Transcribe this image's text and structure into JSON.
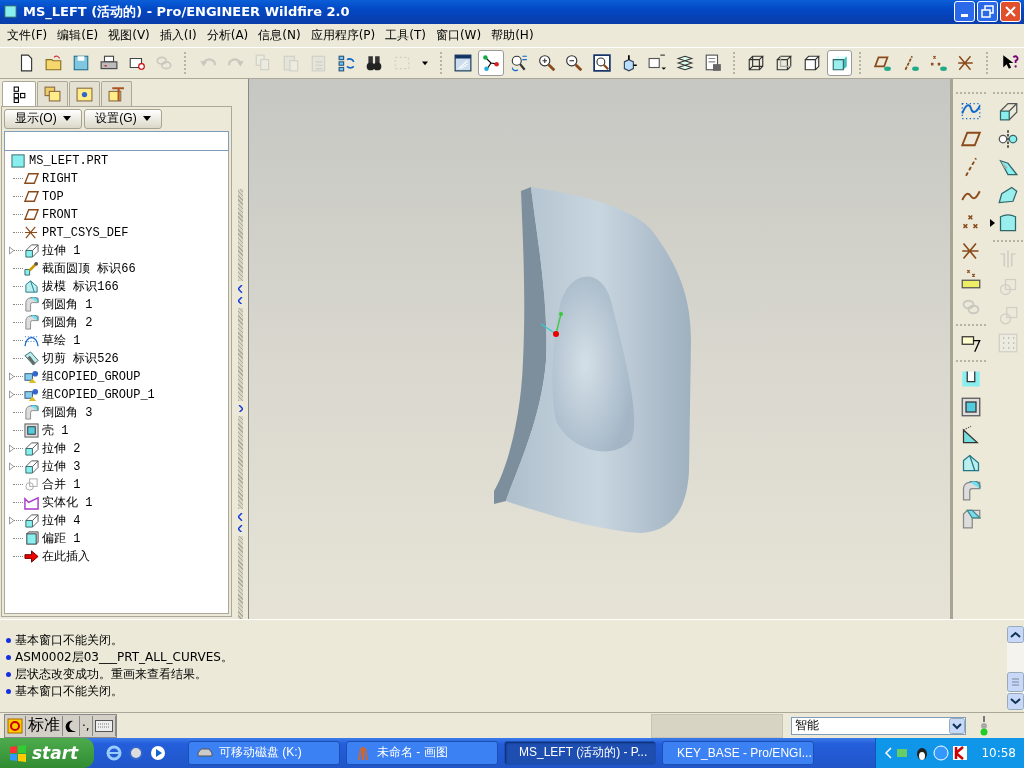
{
  "window": {
    "title": "MS_LEFT (活动的) - Pro/ENGINEER Wildfire 2.0"
  },
  "menu": [
    "文件(F)",
    "编辑(E)",
    "视图(V)",
    "插入(I)",
    "分析(A)",
    "信息(N)",
    "应用程序(P)",
    "工具(T)",
    "窗口(W)",
    "帮助(H)"
  ],
  "toolbar": [
    [
      {
        "kind": "new",
        "pressed": false,
        "disabled": false
      },
      {
        "kind": "open",
        "pressed": false,
        "disabled": false
      },
      {
        "kind": "save",
        "pressed": false,
        "disabled": false
      },
      {
        "kind": "print",
        "pressed": false,
        "disabled": false
      },
      {
        "kind": "mail",
        "pressed": false,
        "disabled": false
      },
      {
        "kind": "link",
        "pressed": false,
        "disabled": true
      }
    ],
    [
      {
        "kind": "undo",
        "pressed": false,
        "disabled": true
      },
      {
        "kind": "redo",
        "pressed": false,
        "disabled": true
      },
      {
        "kind": "copy",
        "pressed": false,
        "disabled": true
      },
      {
        "kind": "paste",
        "pressed": false,
        "disabled": true
      },
      {
        "kind": "pastespecial",
        "pressed": false,
        "disabled": true
      },
      {
        "kind": "regen",
        "pressed": false,
        "disabled": false
      },
      {
        "kind": "find",
        "pressed": false,
        "disabled": false
      },
      {
        "kind": "selectbox",
        "pressed": false,
        "disabled": true
      },
      {
        "kind": "dropdown",
        "pressed": false,
        "disabled": false
      }
    ],
    [
      {
        "kind": "repaint",
        "pressed": false,
        "disabled": false
      },
      {
        "kind": "spin",
        "pressed": true,
        "disabled": false
      },
      {
        "kind": "orient",
        "pressed": false,
        "disabled": false
      },
      {
        "kind": "zoomin",
        "pressed": false,
        "disabled": false
      },
      {
        "kind": "zoomout",
        "pressed": false,
        "disabled": false
      },
      {
        "kind": "refit",
        "pressed": false,
        "disabled": false
      },
      {
        "kind": "reorient",
        "pressed": false,
        "disabled": false
      },
      {
        "kind": "views",
        "pressed": false,
        "disabled": false
      },
      {
        "kind": "layers",
        "pressed": false,
        "disabled": false
      },
      {
        "kind": "viewmgr",
        "pressed": false,
        "disabled": false
      }
    ],
    [
      {
        "kind": "wire",
        "pressed": false,
        "disabled": false
      },
      {
        "kind": "hidden",
        "pressed": false,
        "disabled": false
      },
      {
        "kind": "nohidden",
        "pressed": false,
        "disabled": false
      },
      {
        "kind": "shaded",
        "pressed": true,
        "disabled": false
      }
    ],
    [
      {
        "kind": "planes",
        "pressed": false,
        "disabled": false
      },
      {
        "kind": "axes",
        "pressed": false,
        "disabled": false
      },
      {
        "kind": "points",
        "pressed": false,
        "disabled": false
      },
      {
        "kind": "csys",
        "pressed": false,
        "disabled": false
      }
    ],
    [
      {
        "kind": "help",
        "pressed": false,
        "disabled": false
      }
    ]
  ],
  "panel_tabs": [
    {
      "kind": "tree",
      "selected": true
    },
    {
      "kind": "folders",
      "selected": false
    },
    {
      "kind": "favorites",
      "selected": false
    },
    {
      "kind": "tools",
      "selected": false
    }
  ],
  "panel_buttons": [
    "显示(O)",
    "设置(G)"
  ],
  "model_tree": [
    {
      "label": "MS_LEFT.PRT",
      "kind": "part",
      "collapsed": false,
      "children": [
        {
          "label": "RIGHT",
          "kind": "plane",
          "collapsed": false
        },
        {
          "label": "TOP",
          "kind": "plane",
          "collapsed": false
        },
        {
          "label": "FRONT",
          "kind": "plane",
          "collapsed": false
        },
        {
          "label": "PRT_CSYS_DEF",
          "kind": "csys",
          "collapsed": false
        },
        {
          "label": "拉伸 1",
          "kind": "extrude",
          "collapsed": true
        },
        {
          "label": "截面圆顶 标识66",
          "kind": "dome",
          "collapsed": false
        },
        {
          "label": "拔模 标识166",
          "kind": "draft",
          "collapsed": false
        },
        {
          "label": "倒圆角 1",
          "kind": "round",
          "collapsed": false
        },
        {
          "label": "倒圆角 2",
          "kind": "round",
          "collapsed": false
        },
        {
          "label": "草绘 1",
          "kind": "sketch",
          "collapsed": false
        },
        {
          "label": "切剪 标识526",
          "kind": "cut",
          "collapsed": false
        },
        {
          "label": "组COPIED_GROUP",
          "kind": "group",
          "collapsed": true
        },
        {
          "label": "组COPIED_GROUP_1",
          "kind": "group",
          "collapsed": true
        },
        {
          "label": "倒圆角 3",
          "kind": "round",
          "collapsed": false
        },
        {
          "label": "壳 1",
          "kind": "shell",
          "collapsed": false
        },
        {
          "label": "拉伸 2",
          "kind": "extrude",
          "collapsed": true
        },
        {
          "label": "拉伸 3",
          "kind": "extrude",
          "collapsed": true
        },
        {
          "label": "合并 1",
          "kind": "merge",
          "collapsed": false
        },
        {
          "label": "实体化 1",
          "kind": "solidify",
          "collapsed": false
        },
        {
          "label": "拉伸 4",
          "kind": "extrude",
          "collapsed": true
        },
        {
          "label": "偏距 1",
          "kind": "offset",
          "collapsed": false
        },
        {
          "label": "在此插入",
          "kind": "insert",
          "collapsed": false
        }
      ]
    }
  ],
  "side_toolbar": {
    "column_1": [
      {
        "kind": "sketchcurve",
        "disabled": false,
        "flyout": false
      },
      {
        "kind": "plane",
        "disabled": false,
        "flyout": false
      },
      {
        "kind": "axis",
        "disabled": false,
        "flyout": false
      },
      {
        "kind": "curve",
        "disabled": false,
        "flyout": false
      },
      {
        "kind": "point",
        "disabled": false,
        "flyout": true
      },
      {
        "kind": "csys",
        "disabled": false,
        "flyout": false
      },
      {
        "kind": "analysis",
        "disabled": false,
        "flyout": false
      },
      {
        "kind": "link",
        "disabled": true,
        "flyout": false
      },
      {
        "kind": "separator"
      },
      {
        "kind": "note",
        "disabled": false,
        "flyout": false
      },
      {
        "kind": "separator"
      },
      {
        "kind": "hole",
        "disabled": false,
        "flyout": false
      },
      {
        "kind": "shell",
        "disabled": false,
        "flyout": false
      },
      {
        "kind": "rib",
        "disabled": false,
        "flyout": false
      },
      {
        "kind": "draft",
        "disabled": false,
        "flyout": false
      },
      {
        "kind": "round",
        "disabled": false,
        "flyout": false
      },
      {
        "kind": "chamfer",
        "disabled": false,
        "flyout": false
      }
    ],
    "column_2": [
      {
        "kind": "extrude",
        "disabled": false,
        "flyout": false
      },
      {
        "kind": "revolve",
        "disabled": false,
        "flyout": false
      },
      {
        "kind": "sweep",
        "disabled": false,
        "flyout": false
      },
      {
        "kind": "blend",
        "disabled": false,
        "flyout": false
      },
      {
        "kind": "fill",
        "disabled": false,
        "flyout": false
      },
      {
        "kind": "separator"
      },
      {
        "kind": "mirror",
        "disabled": true,
        "flyout": false
      },
      {
        "kind": "merge",
        "disabled": true,
        "flyout": false
      },
      {
        "kind": "intersect",
        "disabled": true,
        "flyout": false
      },
      {
        "kind": "pattern",
        "disabled": true,
        "flyout": false
      }
    ]
  },
  "messages": [
    "基本窗口不能关闭。",
    "ASM0002层03___PRT_ALL_CURVES。",
    "层状态改变成功。重画来查看结果。",
    "基本窗口不能关闭。"
  ],
  "status_bar": {
    "ime_mode": "标准",
    "ime_punct": "·,",
    "filter": "智能"
  },
  "taskbar": {
    "start": "start",
    "tasks": [
      {
        "label": "可移动磁盘 (K:)",
        "kind": "drive",
        "selected": false
      },
      {
        "label": "未命名 - 画图",
        "kind": "paint",
        "selected": false
      },
      {
        "label": "MS_LEFT (活动的) - P...",
        "kind": "proe",
        "selected": true
      },
      {
        "label": "KEY_BASE - Pro/ENGI...",
        "kind": "proe",
        "selected": false
      }
    ],
    "clock": "10:58"
  }
}
